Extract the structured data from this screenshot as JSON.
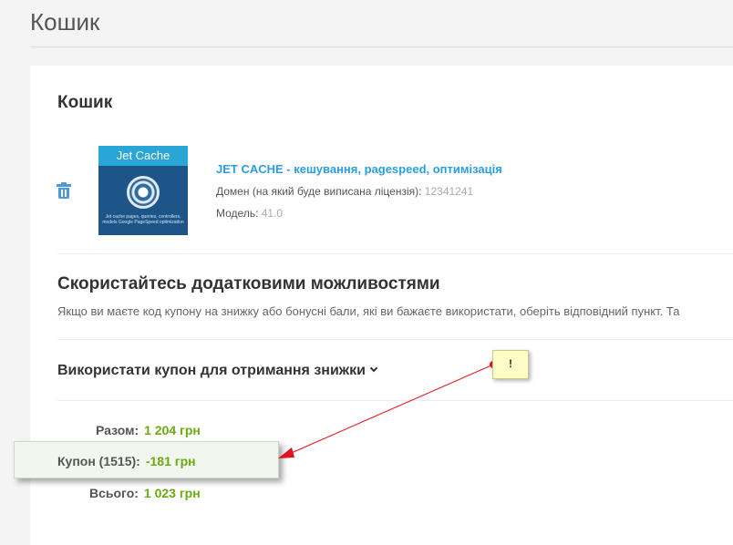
{
  "page": {
    "title": "Кошик"
  },
  "cart": {
    "title": "Кошик",
    "product": {
      "image_caption": "Jet Cache",
      "image_small_text": "Jet cache pages, queries, controllers, models Google PageSpeed optimization",
      "name": "JET CACHE - кешування, pagespeed, оптимізація",
      "domain_label": "Домен (на який буде виписана ліцензія):",
      "domain_value": "12341241",
      "model_label": "Модель:",
      "model_value": "41.0"
    }
  },
  "extras": {
    "title": "Скористайтесь додатковими можливостями",
    "description": "Якщо ви маєте код купону на знижку або бонусні бали, які ви бажаєте використати, оберіть відповідний пункт. Та",
    "coupon_toggle": "Використати купон для отримання знижки"
  },
  "totals": {
    "subtotal": {
      "label": "Разом:",
      "value": "1 204 грн"
    },
    "coupon": {
      "label": "Купон (1515):",
      "value": "-181 грн"
    },
    "total": {
      "label": "Всього:",
      "value": "1 023 грн"
    }
  },
  "annotation": {
    "note_text": "!"
  },
  "colors": {
    "accent_link": "#2b9ee0",
    "price_green": "#6aaa12",
    "arrow_red": "#e0141c"
  }
}
